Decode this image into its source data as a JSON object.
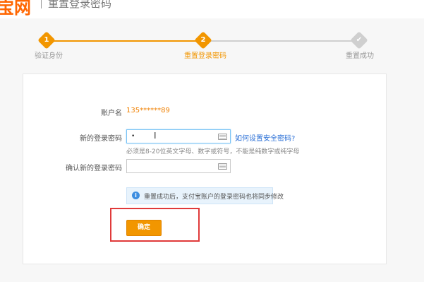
{
  "header": {
    "brand": "宝网",
    "title": "重置登录密码"
  },
  "steps": [
    {
      "number": "1",
      "label": "验证身份",
      "state": "done"
    },
    {
      "number": "2",
      "label": "重置登录密码",
      "state": "current"
    },
    {
      "number": "✔",
      "label": "重置成功",
      "state": "todo"
    }
  ],
  "form": {
    "account_label": "账户名",
    "account_value": "135******89",
    "new_password_label": "新的登录密码",
    "new_password_value": "•",
    "help_link": "如何设置安全密码?",
    "hint": "必须是8-20位英文字母、数字或符号，不能是纯数字或纯字母",
    "confirm_password_label": "确认新的登录密码",
    "confirm_password_value": "",
    "notice": "重置成功后，支付宝账户的登录密码也将同步修改",
    "confirm_button": "确定"
  },
  "colors": {
    "accent": "#f29600",
    "link": "#2a6fd6",
    "highlight": "#e03a3a"
  }
}
